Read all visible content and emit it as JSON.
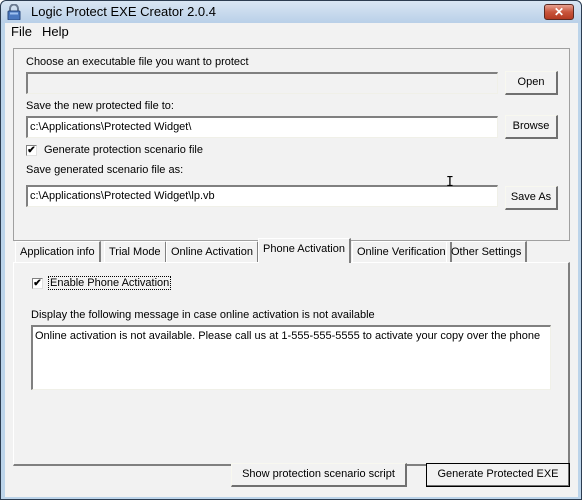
{
  "window": {
    "title": "Logic Protect EXE Creator 2.0.4",
    "icon": "lock-icon",
    "close_label": "✕"
  },
  "menu": {
    "items": [
      {
        "label": "File"
      },
      {
        "label": "Help"
      }
    ]
  },
  "files": {
    "executable_label": "Choose an executable file you want to protect",
    "executable_value": "",
    "open_button": "Open",
    "save_to_label": "Save the new protected file to:",
    "save_to_value": "c:\\Applications\\Protected Widget\\",
    "browse_button": "Browse",
    "generate_scenario_label": "Generate protection scenario file",
    "generate_scenario_checked": true,
    "scenario_file_label": "Save generated scenario file as:",
    "scenario_file_value": "c:\\Applications\\Protected Widget\\lp.vb",
    "save_as_button": "Save As"
  },
  "tabs": [
    {
      "label": "Application info",
      "active": false
    },
    {
      "label": "Trial Mode",
      "active": false
    },
    {
      "label": "Online Activation",
      "active": false
    },
    {
      "label": "Phone Activation",
      "active": true
    },
    {
      "label": "Online Verification",
      "active": false
    },
    {
      "label": "Other Settings",
      "active": false
    }
  ],
  "phone_activation": {
    "enable_label": "Enable Phone Activation",
    "enable_checked": true,
    "message_label": "Display the following message in case online activation is not available",
    "message_value": "Online activation is not available. Please call us at 1-555-555-5555 to activate your copy over the phone"
  },
  "footer": {
    "show_script_button": "Show protection scenario script",
    "generate_button": "Generate Protected EXE"
  },
  "check_mark": "✔"
}
